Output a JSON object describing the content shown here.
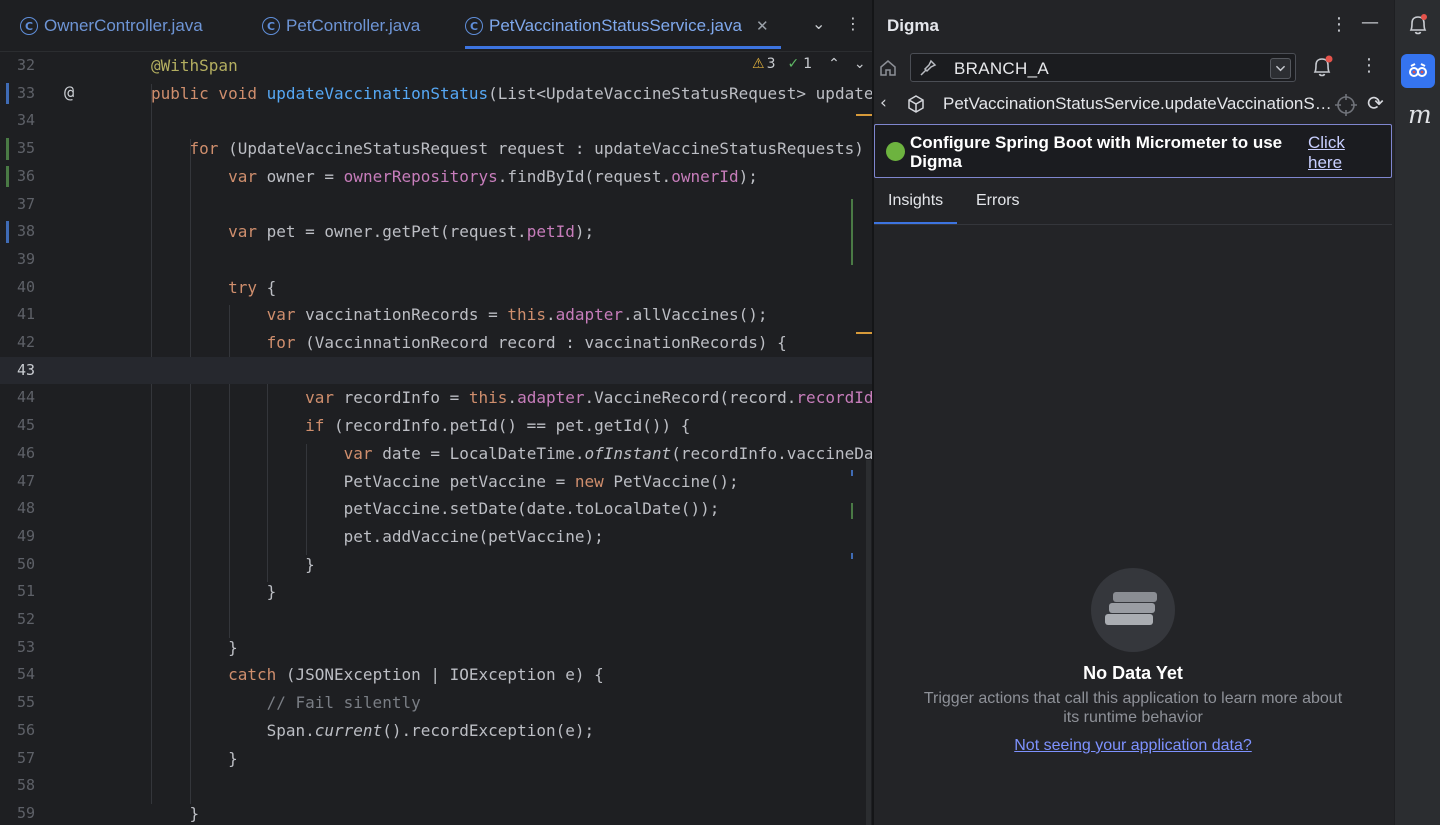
{
  "editor": {
    "tabs": [
      {
        "label": "OwnerController.java",
        "active": false
      },
      {
        "label": "PetController.java",
        "active": false
      },
      {
        "label": "PetVaccinationStatusService.java",
        "active": true
      }
    ],
    "inspection": {
      "warnings": "3",
      "checks": "1"
    },
    "current_line": 43,
    "lines": [
      {
        "n": "32",
        "html": "<span class=\"ann\">@WithSpan</span>"
      },
      {
        "n": "33",
        "html": "<span class=\"kw\">public void </span><span class=\"fn\">updateVaccinationStatus</span>(List&lt;UpdateVaccineStatusRequest&gt; updateVaccineStatusRequests)"
      },
      {
        "n": "34",
        "html": ""
      },
      {
        "n": "35",
        "html": "    <span class=\"kw\">for</span> (UpdateVaccineStatusRequest request : updateVaccineStatusRequests) {"
      },
      {
        "n": "36",
        "html": "        <span class=\"kw\">var</span> owner = <span class=\"fld\">ownerRepositorys</span>.findById(request.<span class=\"fld\">ownerId</span>);"
      },
      {
        "n": "37",
        "html": ""
      },
      {
        "n": "38",
        "html": "        <span class=\"kw\">var</span> pet = owner.getPet(request.<span class=\"fld\">petId</span>);"
      },
      {
        "n": "39",
        "html": ""
      },
      {
        "n": "40",
        "html": "        <span class=\"kw\">try</span> {"
      },
      {
        "n": "41",
        "html": "            <span class=\"kw\">var</span> vaccinationRecords = <span class=\"kw\">this</span>.<span class=\"fld\">adapter</span>.allVaccines();"
      },
      {
        "n": "42",
        "html": "            <span class=\"kw\">for</span> (VaccinnationRecord record : vaccinationRecords) {"
      },
      {
        "n": "43",
        "html": ""
      },
      {
        "n": "44",
        "html": "                <span class=\"kw\">var</span> recordInfo = <span class=\"kw\">this</span>.<span class=\"fld\">adapter</span>.VaccineRecord(record.<span class=\"fld\">recordId</span>);"
      },
      {
        "n": "45",
        "html": "                <span class=\"kw\">if</span> (recordInfo.petId() == pet.getId()) {"
      },
      {
        "n": "46",
        "html": "                    <span class=\"kw\">var</span> date = LocalDateTime.<span class=\"it\">ofInstant</span>(recordInfo.vaccineDate());"
      },
      {
        "n": "47",
        "html": "                    PetVaccine petVaccine = <span class=\"kw\">new</span> PetVaccine();"
      },
      {
        "n": "48",
        "html": "                    petVaccine.setDate(date.toLocalDate());"
      },
      {
        "n": "49",
        "html": "                    pet.addVaccine(petVaccine);"
      },
      {
        "n": "50",
        "html": "                }"
      },
      {
        "n": "51",
        "html": "            }"
      },
      {
        "n": "52",
        "html": ""
      },
      {
        "n": "53",
        "html": "        }"
      },
      {
        "n": "54",
        "html": "        <span class=\"kw\">catch</span> (JSONException | IOException e) {"
      },
      {
        "n": "55",
        "html": "            <span class=\"cm\">// Fail silently</span>"
      },
      {
        "n": "56",
        "html": "            Span.<span class=\"it\">current</span>().recordException(e);"
      },
      {
        "n": "57",
        "html": "        }"
      },
      {
        "n": "58",
        "html": ""
      },
      {
        "n": "59",
        "html": "    }"
      }
    ]
  },
  "digma": {
    "title": "Digma",
    "branch": "BRANCH_A",
    "breadcrumb": "PetVaccinationStatusService.updateVaccinationStatus",
    "banner": {
      "text": "Configure Spring Boot with Micrometer to use Digma",
      "link": "Click here"
    },
    "tabs": [
      {
        "label": "Insights",
        "active": true
      },
      {
        "label": "Errors",
        "active": false
      }
    ],
    "empty": {
      "title": "No Data Yet",
      "description": "Trigger actions that call this application to learn more about its runtime behavior",
      "link": "Not seeing your application data?"
    }
  },
  "rightbar": {
    "m_label": "m"
  },
  "colors": {
    "accent": "#3574f0",
    "banner_border": "#7f86cf",
    "link": "#7e92ff",
    "spring": "#6db33f"
  }
}
